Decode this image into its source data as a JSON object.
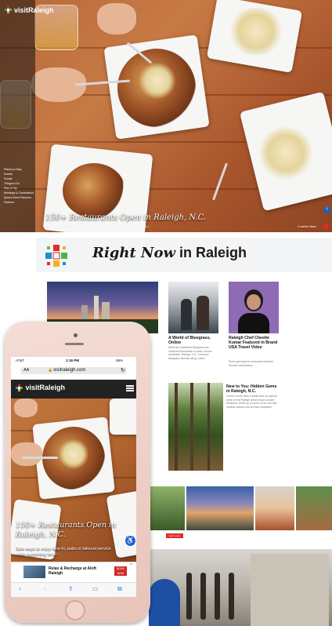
{
  "hero": {
    "logo_text": "visitRaleigh",
    "menu_items": [
      "Places to Stay",
      "Events",
      "Foodie",
      "Things to Do",
      "Plan a Trip",
      "Meetings & Conventions",
      "Sports Event Planners",
      "Partners"
    ],
    "caption": "150+ Restaurants Open in Raleigh, N.C.",
    "subcaption": "Safe ways to enjoy dine-in, patio or takeout service while supporting local ›",
    "photo_credit": "Crushfire Wave"
  },
  "right_now": {
    "script_text": "Right Now",
    "plain_text": "in Raleigh"
  },
  "articles": [
    {
      "title": "A World of Bluegrass, Online",
      "text": "While the traditional bluegrass has canceled thousands of music venues worldwide, Raleigh, N.C.'s famous bluegrass identity will go online"
    },
    {
      "title": "Raleigh Chef Cheetie Kumar Featured in Brand USA Travel Video",
      "text": "Since opening her restaurant Garland, Kumar's adventures..."
    },
    {
      "title": "New to You: Hidden Gems in Raleigh, N.C.",
      "text": "There's never been a better time to explore some of the Raleigh area's lesser-known treasures. Read up on some of our favorite outdoor spaces and art that compelled"
    }
  ],
  "learn_more_label": "learn more",
  "phone": {
    "status_carrier": "AT&T",
    "status_time": "1:16 PM",
    "status_battery": "59%",
    "url_prefix": "AA",
    "url": "visitraleigh.com",
    "logo_text": "visitRaleigh",
    "caption": "150+ Restaurants Open in Raleigh, N.C.",
    "subcaption": "Safe ways to enjoy dine-in, patio or takeout service while supporting local ›",
    "ad_title": "Relax & Recharge at Aloft Raleigh",
    "ad_button": "BOOK NOW"
  },
  "colors": {
    "accent_red": "#e02b2b",
    "nav_dark": "#222222",
    "link_blue": "#2a73e8"
  }
}
